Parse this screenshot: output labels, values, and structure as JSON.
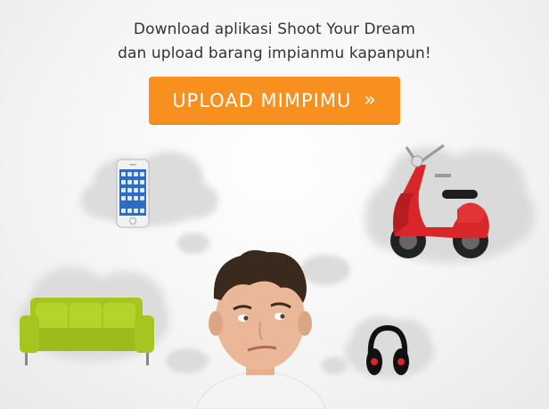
{
  "promo": {
    "headline_line1": "Download aplikasi Shoot Your Dream",
    "headline_line2": "dan upload barang impianmu kapanpun!",
    "cta_label": "UPLOAD MIMPIMU",
    "cta_chevron": "»"
  },
  "colors": {
    "cta_bg": "#f7901e",
    "scooter": "#d8262a",
    "sofa": "#a6c520"
  },
  "icons": [
    "phone-icon",
    "scooter-icon",
    "sofa-icon",
    "headphones-icon"
  ]
}
